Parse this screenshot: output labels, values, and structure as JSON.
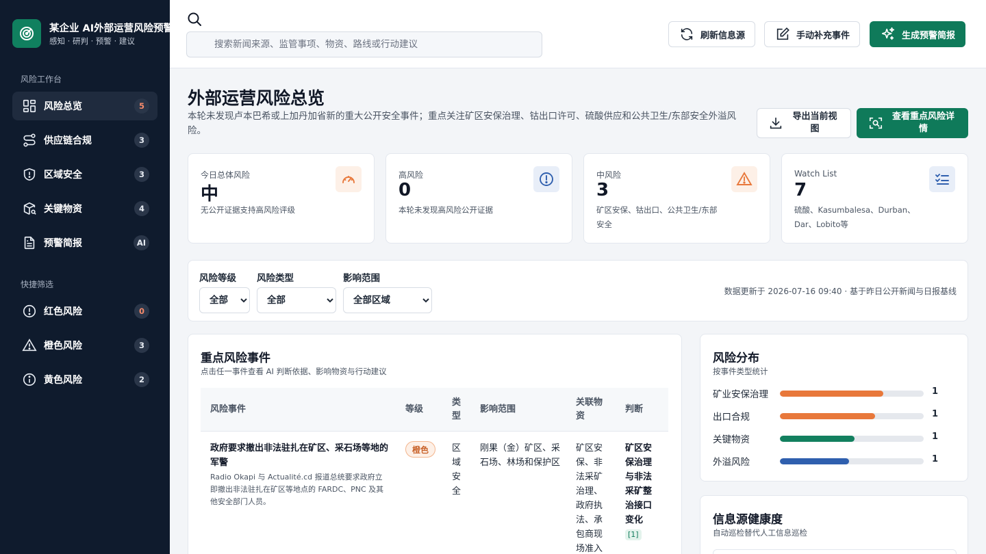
{
  "brand": {
    "title": "某企业 AI外部运营风险预警",
    "subtitle": "感知 · 研判 · 预警 · 建议"
  },
  "sidebar": {
    "section_workbench": "风险工作台",
    "workbench_items": [
      {
        "label": "风险总览",
        "badge": "5",
        "icon": "dashboard-icon"
      },
      {
        "label": "供应链合规",
        "badge": "3",
        "icon": "route-icon"
      },
      {
        "label": "区域安全",
        "badge": "3",
        "icon": "shield-icon"
      },
      {
        "label": "关键物资",
        "badge": "4",
        "icon": "package-search-icon"
      },
      {
        "label": "预警简报",
        "badge": "AI",
        "icon": "document-icon"
      }
    ],
    "section_filters": "快捷筛选",
    "filter_items": [
      {
        "label": "红色风险",
        "badge": "0",
        "icon": "alert-circle-icon"
      },
      {
        "label": "橙色风险",
        "badge": "3",
        "icon": "alert-triangle-icon"
      },
      {
        "label": "黄色风险",
        "badge": "2",
        "icon": "info-circle-icon"
      }
    ]
  },
  "topbar": {
    "search_placeholder": "搜索新闻来源、监管事项、物资、路线或行动建议",
    "refresh_label": "刷新信息源",
    "manual_label": "手动补充事件",
    "generate_label": "生成预警简报"
  },
  "page": {
    "title": "外部运营风险总览",
    "description": "本轮未发现卢本巴希或上加丹加省新的重大公开安全事件；重点关注矿区安保治理、钴出口许可、硫酸供应和公共卫生/东部安全外溢风险。",
    "export_label": "导出当前视图",
    "detail_label": "查看重点风险详情"
  },
  "stats": [
    {
      "label": "今日总体风险",
      "value": "中",
      "desc": "无公开证据支持高风险评级",
      "icon": "gauge-icon",
      "color": "#e8783b",
      "bg": "#fdf0e7"
    },
    {
      "label": "高风险",
      "value": "0",
      "desc": "本轮未发现高风险公开证据",
      "icon": "alert-circle-icon",
      "color": "#2f5fae",
      "bg": "#e8eef8"
    },
    {
      "label": "中风险",
      "value": "3",
      "desc": "矿区安保、钴出口、公共卫生/东部安全",
      "icon": "alert-triangle-icon",
      "color": "#e8783b",
      "bg": "#fdf0e7"
    },
    {
      "label": "Watch List",
      "value": "7",
      "desc": "硫酸、Kasumbalesa、Durban、Dar、Lobito等",
      "icon": "checklist-icon",
      "color": "#2f5fae",
      "bg": "#e8eef8"
    }
  ],
  "filters": {
    "level_label": "风险等级",
    "level_value": "全部",
    "type_label": "风险类型",
    "type_value": "全部",
    "scope_label": "影响范围",
    "scope_value": "全部区域",
    "update_text": "数据更新于 2026-07-16 09:40 · 基于昨日公开新闻与日报基线"
  },
  "events": {
    "title": "重点风险事件",
    "subtitle": "点击任一事件查看 AI 判断依据、影响物资与行动建议",
    "columns": {
      "event": "风险事件",
      "level": "等级",
      "type": "类型",
      "scope": "影响范围",
      "materials": "关联物资",
      "judgment": "判断"
    },
    "rows": [
      {
        "title": "政府要求撤出非法驻扎在矿区、采石场等地的军警",
        "desc": "Radio Okapi 与 Actualité.cd 报道总统要求政府立即撤出非法驻扎在矿区等地点的 FARDC、PNC 及其他安全部门人员。",
        "level": "橙色",
        "type": "区域安全",
        "scope": "刚果（金）矿区、采石场、林场和保护区",
        "materials": "矿区安保、非法采矿治理、政府执法、承包商现场准入",
        "judgment": "矿区安保治理与非法采矿整治接口变化",
        "cite": "[1]"
      }
    ]
  },
  "distribution": {
    "title": "风险分布",
    "subtitle": "按事件类型统计",
    "items": [
      {
        "label": "矿业安保治理",
        "count": "1",
        "fill": 0.72,
        "color": "#e8783b"
      },
      {
        "label": "出口合规",
        "count": "1",
        "fill": 0.66,
        "color": "#e8783b"
      },
      {
        "label": "关键物资",
        "count": "1",
        "fill": 0.52,
        "color": "#13805f"
      },
      {
        "label": "外溢风险",
        "count": "1",
        "fill": 0.48,
        "color": "#2f5fae"
      }
    ]
  },
  "health": {
    "title": "信息源健康度",
    "subtitle": "自动巡检替代人工信息巡检"
  }
}
